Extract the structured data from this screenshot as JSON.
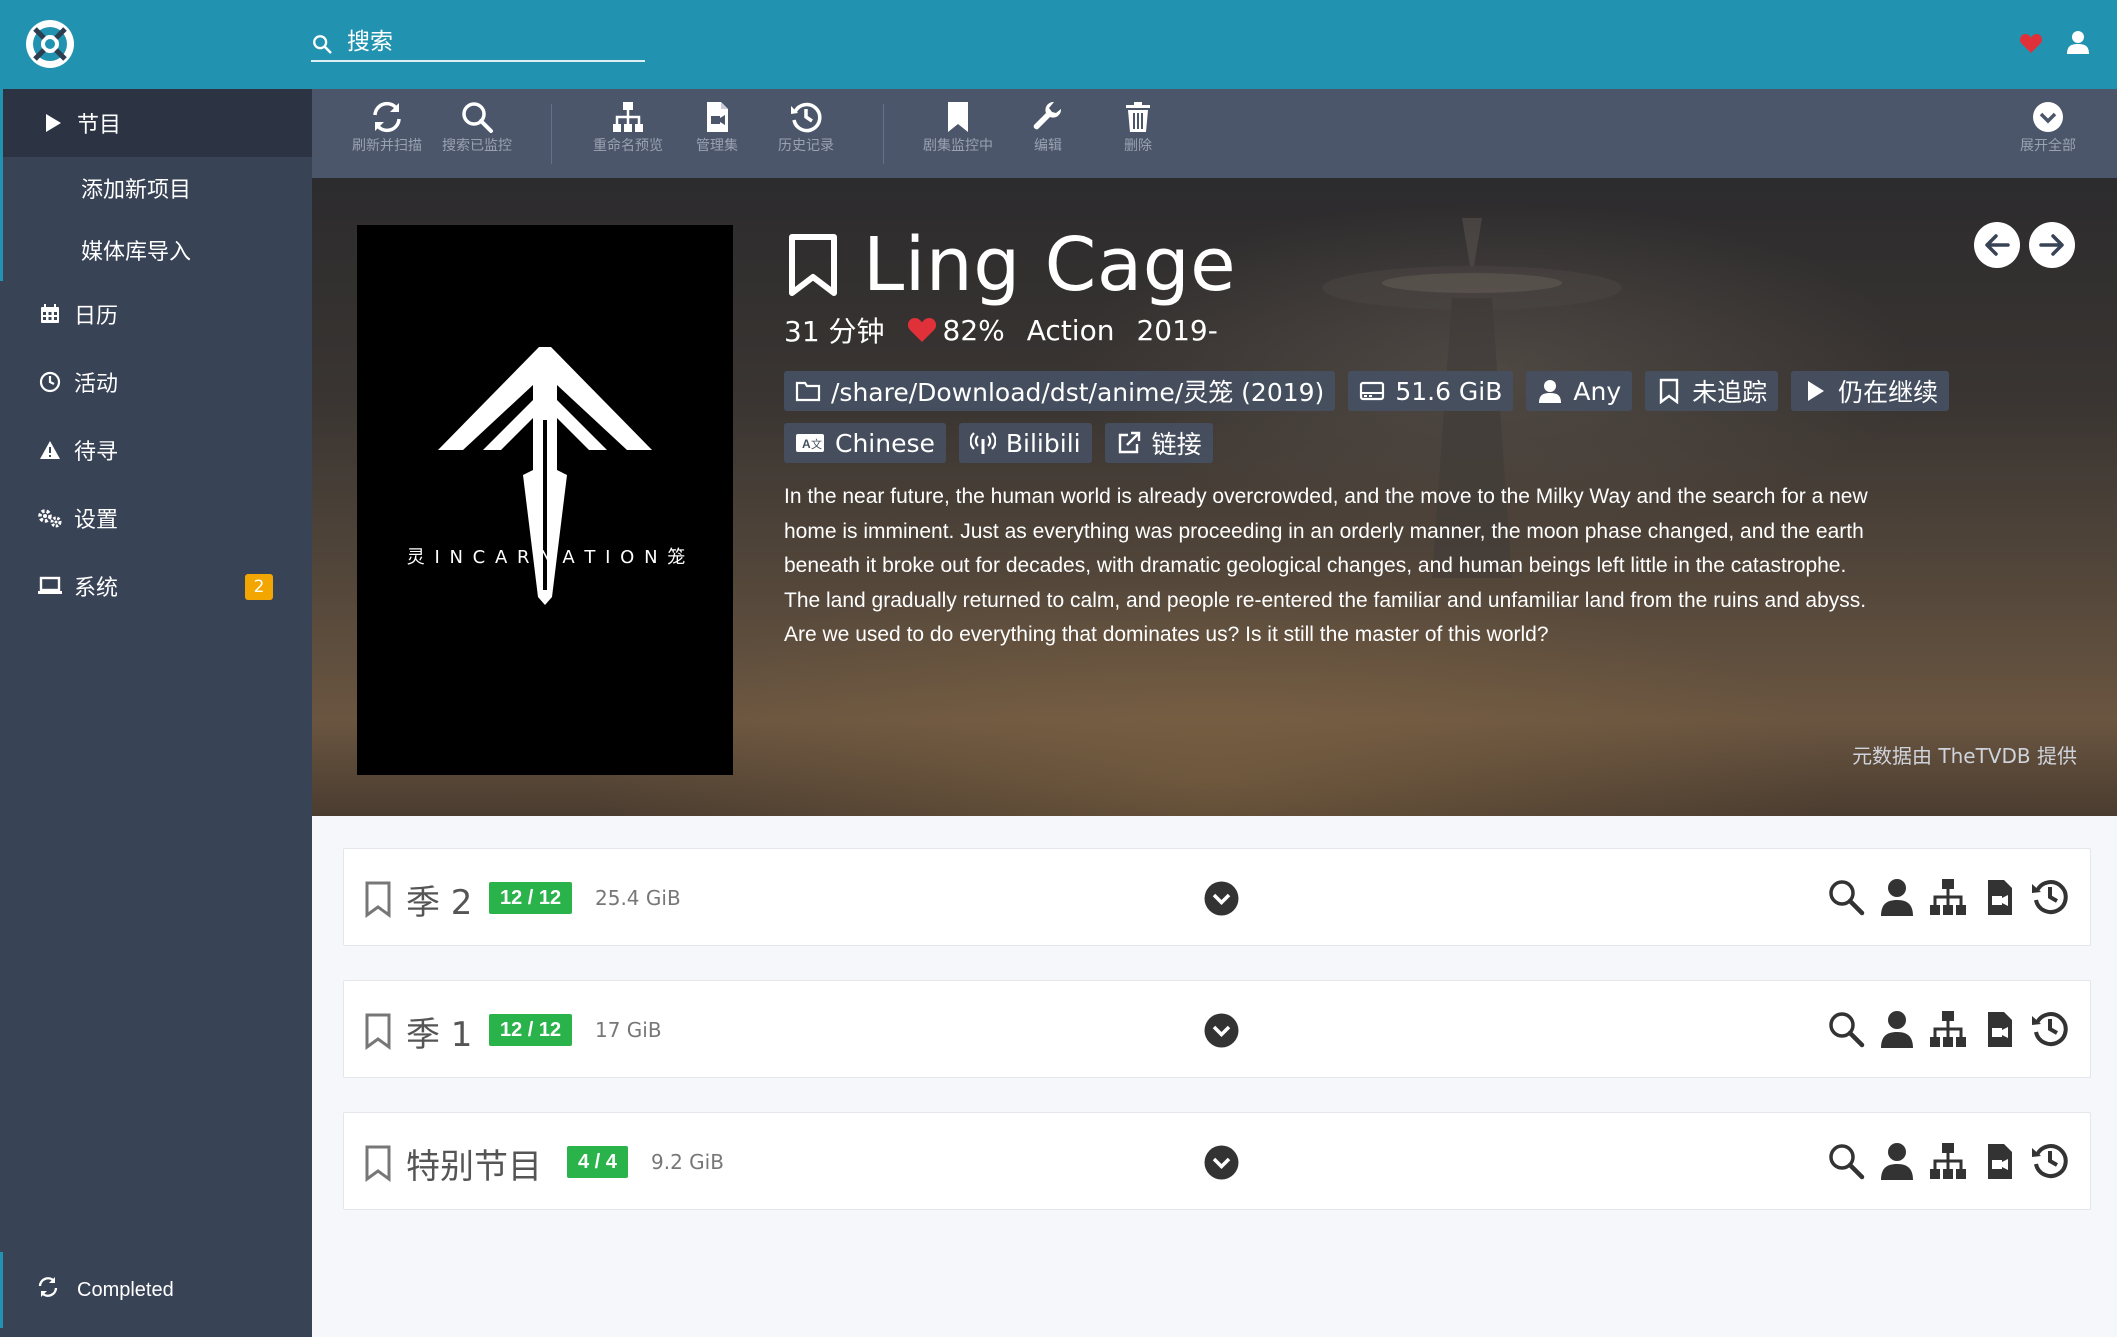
{
  "search": {
    "placeholder": "搜索"
  },
  "sidebar": {
    "items": [
      {
        "label": "节目"
      },
      {
        "label": "添加新项目"
      },
      {
        "label": "媒体库导入"
      },
      {
        "label": "日历"
      },
      {
        "label": "活动"
      },
      {
        "label": "待寻"
      },
      {
        "label": "设置"
      },
      {
        "label": "系统",
        "badge": "2"
      }
    ],
    "status": "Completed"
  },
  "toolbar": {
    "refresh": "刷新并扫描",
    "search_monitored": "搜索已监控",
    "rename_preview": "重命名预览",
    "manage_episodes": "管理集",
    "history": "历史记录",
    "monitoring": "剧集监控中",
    "edit": "编辑",
    "delete": "删除",
    "expand_all": "展开全部"
  },
  "series": {
    "title": "Ling Cage",
    "runtime": "31 分钟",
    "rating": "82%",
    "genre": "Action",
    "year": "2019-",
    "path": "/share/Download/dst/anime/灵笼 (2019)",
    "size": "51.6 GiB",
    "quality_profile": "Any",
    "monitor_status": "未追踪",
    "status": "仍在继续",
    "language": "Chinese",
    "network": "Bilibili",
    "links": "链接",
    "overview": "In the near future, the human world is already overcrowded, and the move to the Milky Way and the search for a new home is imminent. Just as everything was proceeding in an orderly manner, the moon phase changed, and the earth beneath it broke out for decades, with dramatic geological changes, and human beings left little in the catastrophe. The land gradually returned to calm, and people re-entered the familiar and unfamiliar land from the ruins and abyss. Are we used to do everything that dominates us? Is it still the master of this world?",
    "provider": "元数据由 TheTVDB 提供",
    "poster_text": "灵 I N C A R N A T I O N 笼"
  },
  "seasons": [
    {
      "name": "季 2",
      "count": "12 / 12",
      "size": "25.4 GiB"
    },
    {
      "name": "季 1",
      "count": "12 / 12",
      "size": "17 GiB"
    },
    {
      "name": "特别节目",
      "count": "4 / 4",
      "size": "9.2 GiB"
    }
  ],
  "colors": {
    "topbar": "#2193b0",
    "sidebar": "#394356",
    "toolbar": "#4b566b",
    "badge": "#f4a600",
    "episode_count": "#29b34a",
    "heart": "#e0303a"
  }
}
